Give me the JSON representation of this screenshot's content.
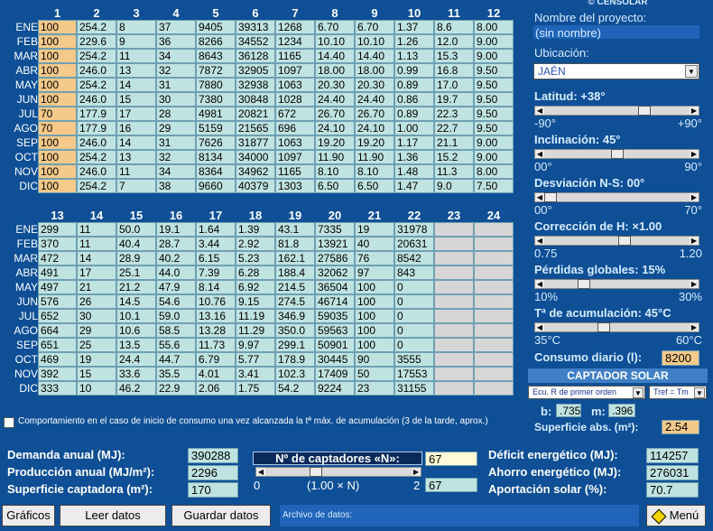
{
  "top_cols": [
    "1",
    "2",
    "3",
    "4",
    "5",
    "6",
    "7",
    "8",
    "9",
    "10",
    "11",
    "12"
  ],
  "bot_cols": [
    "13",
    "14",
    "15",
    "16",
    "17",
    "18",
    "19",
    "20",
    "21",
    "22",
    "23",
    "24"
  ],
  "months": [
    "ENE",
    "FEB",
    "MAR",
    "ABR",
    "MAY",
    "JUN",
    "JUL",
    "AGO",
    "SEP",
    "OCT",
    "NOV",
    "DIC"
  ],
  "top_rows": [
    [
      "100",
      "254.2",
      "8",
      "37",
      "9405",
      "39313",
      "1268",
      "6.70",
      "6.70",
      "1.37",
      "8.6",
      "8.00"
    ],
    [
      "100",
      "229.6",
      "9",
      "36",
      "8266",
      "34552",
      "1234",
      "10.10",
      "10.10",
      "1.26",
      "12.0",
      "9.00"
    ],
    [
      "100",
      "254.2",
      "11",
      "34",
      "8643",
      "36128",
      "1165",
      "14.40",
      "14.40",
      "1.13",
      "15.3",
      "9.00"
    ],
    [
      "100",
      "246.0",
      "13",
      "32",
      "7872",
      "32905",
      "1097",
      "18.00",
      "18.00",
      "0.99",
      "16.8",
      "9.50"
    ],
    [
      "100",
      "254.2",
      "14",
      "31",
      "7880",
      "32938",
      "1063",
      "20.30",
      "20.30",
      "0.89",
      "17.0",
      "9.50"
    ],
    [
      "100",
      "246.0",
      "15",
      "30",
      "7380",
      "30848",
      "1028",
      "24.40",
      "24.40",
      "0.86",
      "19.7",
      "9.50"
    ],
    [
      "70",
      "177.9",
      "17",
      "28",
      "4981",
      "20821",
      "672",
      "26.70",
      "26.70",
      "0.89",
      "22.3",
      "9.50"
    ],
    [
      "70",
      "177.9",
      "16",
      "29",
      "5159",
      "21565",
      "696",
      "24.10",
      "24.10",
      "1.00",
      "22.7",
      "9.50"
    ],
    [
      "100",
      "246.0",
      "14",
      "31",
      "7626",
      "31877",
      "1063",
      "19.20",
      "19.20",
      "1.17",
      "21.1",
      "9.00"
    ],
    [
      "100",
      "254.2",
      "13",
      "32",
      "8134",
      "34000",
      "1097",
      "11.90",
      "11.90",
      "1.36",
      "15.2",
      "9.00"
    ],
    [
      "100",
      "246.0",
      "11",
      "34",
      "8364",
      "34962",
      "1165",
      "8.10",
      "8.10",
      "1.48",
      "11.3",
      "8.00"
    ],
    [
      "100",
      "254.2",
      "7",
      "38",
      "9660",
      "40379",
      "1303",
      "6.50",
      "6.50",
      "1.47",
      "9.0",
      "7.50"
    ]
  ],
  "bot_rows": [
    [
      "299",
      "11",
      "50.0",
      "19.1",
      "1.64",
      "1.39",
      "43.1",
      "7335",
      "19",
      "31978",
      "",
      ""
    ],
    [
      "370",
      "11",
      "40.4",
      "28.7",
      "3.44",
      "2.92",
      "81.8",
      "13921",
      "40",
      "20631",
      "",
      ""
    ],
    [
      "472",
      "14",
      "28.9",
      "40.2",
      "6.15",
      "5.23",
      "162.1",
      "27586",
      "76",
      "8542",
      "",
      ""
    ],
    [
      "491",
      "17",
      "25.1",
      "44.0",
      "7.39",
      "6.28",
      "188.4",
      "32062",
      "97",
      "843",
      "",
      ""
    ],
    [
      "497",
      "21",
      "21.2",
      "47.9",
      "8.14",
      "6.92",
      "214.5",
      "36504",
      "100",
      "0",
      "",
      ""
    ],
    [
      "576",
      "26",
      "14.5",
      "54.6",
      "10.76",
      "9.15",
      "274.5",
      "46714",
      "100",
      "0",
      "",
      ""
    ],
    [
      "652",
      "30",
      "10.1",
      "59.0",
      "13.16",
      "11.19",
      "346.9",
      "59035",
      "100",
      "0",
      "",
      ""
    ],
    [
      "664",
      "29",
      "10.6",
      "58.5",
      "13.28",
      "11.29",
      "350.0",
      "59563",
      "100",
      "0",
      "",
      ""
    ],
    [
      "651",
      "25",
      "13.5",
      "55.6",
      "11.73",
      "9.97",
      "299.1",
      "50901",
      "100",
      "0",
      "",
      ""
    ],
    [
      "469",
      "19",
      "24.4",
      "44.7",
      "6.79",
      "5.77",
      "178.9",
      "30445",
      "90",
      "3555",
      "",
      ""
    ],
    [
      "392",
      "15",
      "33.6",
      "35.5",
      "4.01",
      "3.41",
      "102.3",
      "17409",
      "50",
      "17553",
      "",
      ""
    ],
    [
      "333",
      "10",
      "46.2",
      "22.9",
      "2.06",
      "1.75",
      "54.2",
      "9224",
      "23",
      "31155",
      "",
      ""
    ]
  ],
  "right": {
    "copyright": "© CENSOLAR",
    "project_label": "Nombre del proyecto:",
    "project_value": "(sin nombre)",
    "location_label": "Ubicación:",
    "location_value": "JAÉN",
    "latitude_label": "Latitud: +38°",
    "latitude_min": "-90°",
    "latitude_max": "+90°",
    "latitude_level": 0.71,
    "inclination_label": "Inclinación: 45°",
    "inclination_min": "00°",
    "inclination_max": "90°",
    "inclination_level": 0.5,
    "deviation_label": "Desviación N-S: 00°",
    "deviation_min": "00°",
    "deviation_max": "70°",
    "deviation_level": 0.0,
    "correction_label": "Corrección de H: ×1.00",
    "correction_min": "0.75",
    "correction_max": "1.20",
    "correction_level": 0.56,
    "losses_label": "Pérdidas globales: 15%",
    "losses_min": "10%",
    "losses_max": "30%",
    "losses_level": 0.25,
    "accum_label": "Tª de acumulación: 45°C",
    "accum_min": "35°C",
    "accum_max": "60°C",
    "accum_level": 0.4,
    "consumption_label": "Consumo diario (l):",
    "consumption_value": "8200",
    "captador_title": "CAPTADOR SOLAR",
    "ecu_value": "Ecu. R de primer orden",
    "tref_value": "Tref = Tm",
    "b_label": "b:",
    "b_value": ".735",
    "m_label": "m:",
    "m_value": ".396",
    "surface_label": "Superficie abs. (m²):",
    "surface_value": "2.54"
  },
  "checkbox_label": "Comportamiento en el caso de inicio de consumo una vez alcanzada la tª máx. de acumulación (3 de la tarde, aprox.)",
  "summary": {
    "demand_label": "Demanda anual (MJ):",
    "demand_value": "390288",
    "production_label": "Producción anual (MJ/m²):",
    "production_value": "2296",
    "surface_label": "Superficie captadora (m²):",
    "surface_value": "170",
    "captadores_label": "Nº de captadores «N»:",
    "captadores_value": "67",
    "captadores_min": "0",
    "captadores_mid": "(1.00 × N)",
    "captadores_max": "2",
    "captadores_mid_value": "67",
    "captadores_level": 0.33,
    "deficit_label": "Déficit energético (MJ):",
    "deficit_value": "114257",
    "savings_label": "Ahorro energético (MJ):",
    "savings_value": "276031",
    "solar_label": "Aportación solar (%):",
    "solar_value": "70.7"
  },
  "buttons": {
    "graficos": "Gráficos",
    "leer": "Leer datos",
    "guardar": "Guardar datos",
    "archivo_label": "Archivo de datos:",
    "menu": "Menú"
  },
  "colors": {
    "background": "#0e4f96",
    "cell": "#bfe3e0",
    "highlight": "#f5c98a",
    "title_bar": "#3e7fc6"
  }
}
